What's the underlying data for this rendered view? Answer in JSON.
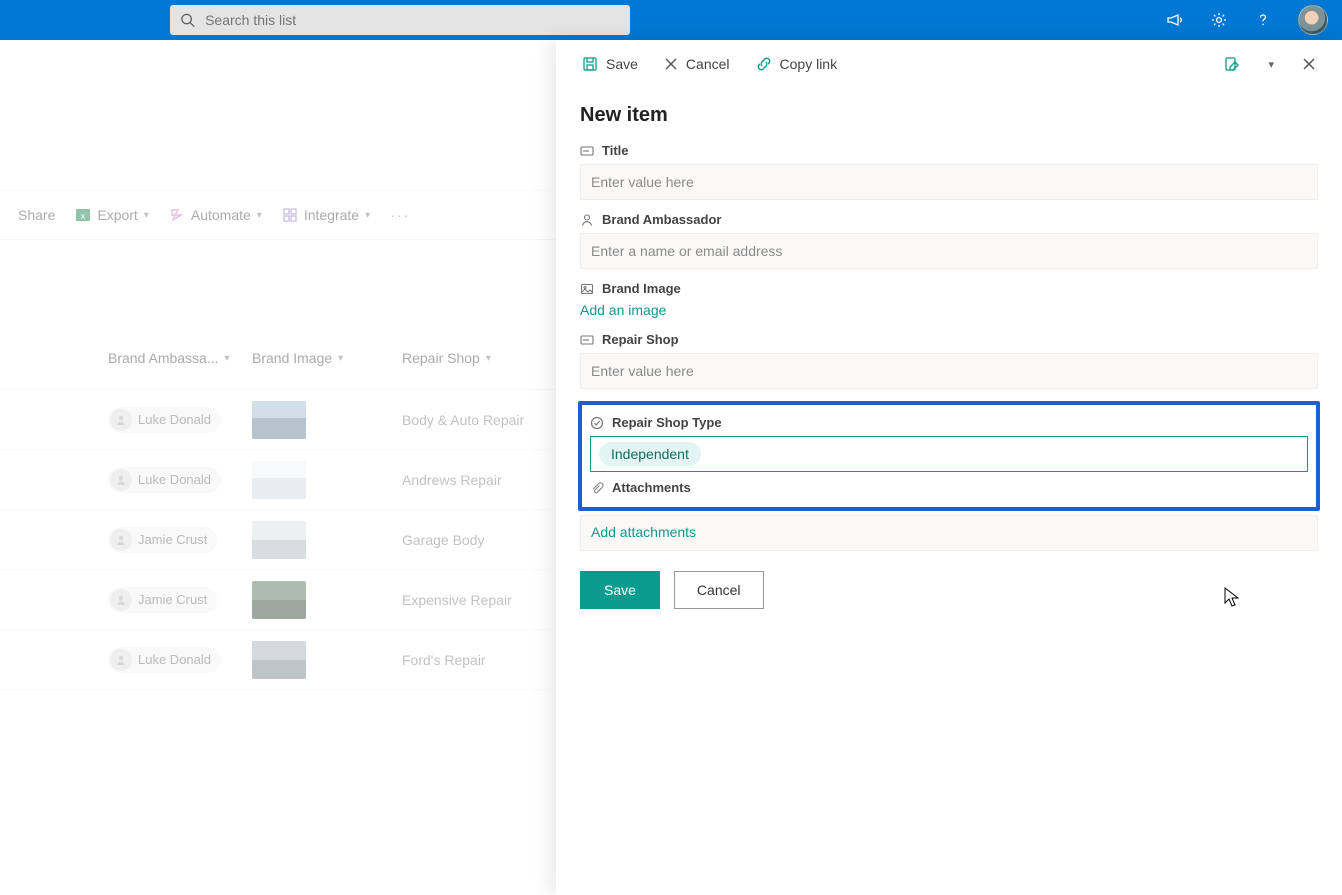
{
  "topbar": {
    "search_placeholder": "Search this list"
  },
  "commandbar": {
    "share": "Share",
    "export": "Export",
    "automate": "Automate",
    "integrate": "Integrate"
  },
  "list": {
    "headers": {
      "ambassador": "Brand Ambassa...",
      "image": "Brand Image",
      "repair_shop": "Repair Shop"
    },
    "rows": [
      {
        "ambassador": "Luke Donald",
        "repair_shop": "Body & Auto Repair"
      },
      {
        "ambassador": "Luke Donald",
        "repair_shop": "Andrews Repair"
      },
      {
        "ambassador": "Jamie Crust",
        "repair_shop": "Garage Body"
      },
      {
        "ambassador": "Jamie Crust",
        "repair_shop": "Expensive Repair"
      },
      {
        "ambassador": "Luke Donald",
        "repair_shop": "Ford's Repair"
      }
    ]
  },
  "panel": {
    "bar": {
      "save": "Save",
      "cancel": "Cancel",
      "copy_link": "Copy link"
    },
    "title": "New item",
    "fields": {
      "title": {
        "label": "Title",
        "placeholder": "Enter value here"
      },
      "ambassador": {
        "label": "Brand Ambassador",
        "placeholder": "Enter a name or email address"
      },
      "image": {
        "label": "Brand Image",
        "action": "Add an image"
      },
      "repair_shop": {
        "label": "Repair Shop",
        "placeholder": "Enter value here"
      },
      "repair_shop_type": {
        "label": "Repair Shop Type",
        "value": "Independent"
      },
      "attachments": {
        "label": "Attachments",
        "action": "Add attachments"
      }
    },
    "actions": {
      "save": "Save",
      "cancel": "Cancel"
    }
  }
}
